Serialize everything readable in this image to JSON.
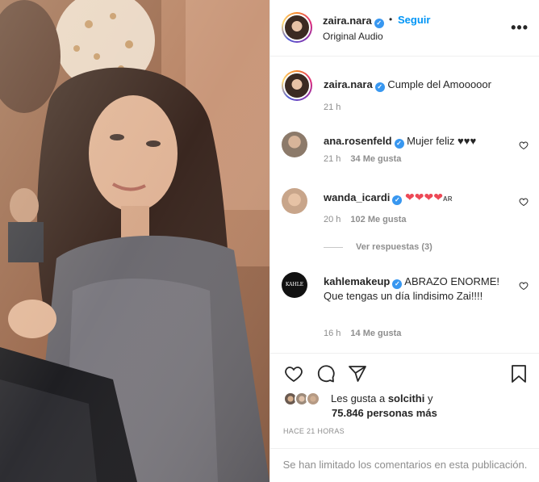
{
  "header": {
    "username": "zaira.nara",
    "follow_label": "Seguir",
    "audio_label": "Original Audio",
    "more_label": "•••"
  },
  "caption": {
    "username": "zaira.nara",
    "text": "Cumple del Amooooor",
    "time": "21 h"
  },
  "comments": [
    {
      "username": "ana.rosenfeld",
      "text": "Mujer feliz ♥♥♥",
      "time": "21 h",
      "likes": "34 Me gusta"
    },
    {
      "username": "wanda_icardi",
      "text": "❤❤❤❤",
      "suffix": "AR",
      "time": "20 h",
      "likes": "102 Me gusta"
    },
    {
      "username": "kahlemakeup",
      "text": "ABRAZO ENORME! Que tengas un día lindisimo Zai!!!!",
      "time": "16 h",
      "likes": "14 Me gusta"
    }
  ],
  "view_replies": "Ver respuestas (3)",
  "kahle_logo": "KAHLE",
  "liked_by": {
    "prefix": "Les gusta a ",
    "user": "solcithi",
    "connector": " y",
    "count": "75.846 personas más"
  },
  "timestamp": "HACE 21 HORAS",
  "comments_limited": "Se han limitado los comentarios en esta publicación.",
  "colors": {
    "link_blue": "#0095f6",
    "verified_blue": "#3897f0",
    "heart_red": "#ed4956",
    "muted": "#8e8e8e"
  },
  "icons": [
    "more-options-icon",
    "verified-badge-icon",
    "heart-outline-icon",
    "comment-icon",
    "share-icon",
    "bookmark-icon"
  ]
}
